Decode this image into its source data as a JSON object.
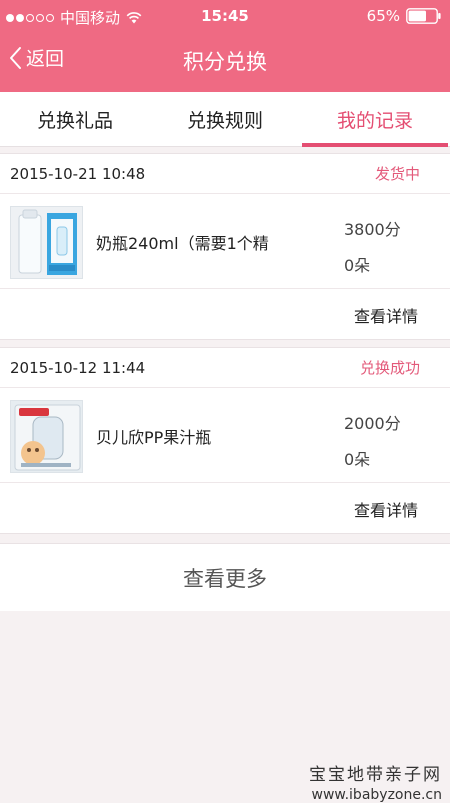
{
  "status_bar": {
    "carrier": "中国移动",
    "time": "15:45",
    "battery": "65%",
    "battery_level": 0.65,
    "signal_bars": 2
  },
  "navbar": {
    "back_label": "返回",
    "title": "积分兑换"
  },
  "tabs": [
    {
      "label": "兑换礼品",
      "active": false
    },
    {
      "label": "兑换规则",
      "active": false
    },
    {
      "label": "我的记录",
      "active": true
    }
  ],
  "orders": [
    {
      "date": "2015-10-21 10:48",
      "status": "发货中",
      "item_name": "奶瓶240ml（需要1个精",
      "points": "3800分",
      "flowers": "0朵",
      "detail_label": "查看详情",
      "thumb_icon": "baby-bottle-box-image"
    },
    {
      "date": "2015-10-12 11:44",
      "status": "兑换成功",
      "item_name": "贝儿欣PP果汁瓶",
      "points": "2000分",
      "flowers": "0朵",
      "detail_label": "查看详情",
      "thumb_icon": "juice-bottle-package-image"
    }
  ],
  "more_label": "查看更多",
  "watermark": {
    "line1": "宝宝地带亲子网",
    "line2": "www.ibabyzone.cn"
  },
  "colors": {
    "brand": "#ef6a83",
    "accent": "#e44e72",
    "status_text": "#e35a7a",
    "background": "#f6f1f2"
  }
}
